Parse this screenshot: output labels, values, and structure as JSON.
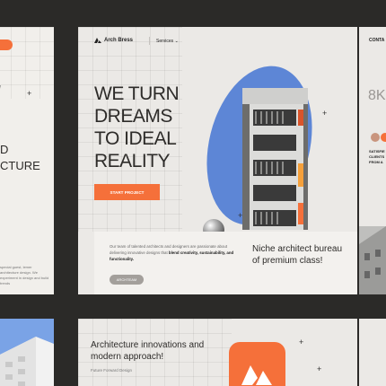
{
  "nav": {
    "brand": "Arch Bress",
    "services": "Services"
  },
  "hero": {
    "title": "WE TURN\nDREAMS\nTO IDEAL\nREALITY",
    "cta": "START PROJECT"
  },
  "info": {
    "text_plain": "Our team of talented architects and designers are passionate about delivering innovative designs that ",
    "text_bold": "blend creativity, sustainability, and functionality.",
    "tag": "ARCHTEAM",
    "tagline": "Niche architect bureau of premium class!"
  },
  "left_preview": {
    "title": "D\nCTURE",
    "small_text": "special guest, lemer architecture design. We experiment in design and build trends"
  },
  "right_preview": {
    "contact": "CONTA",
    "stat": "8K",
    "satisfied": "SATISFIE\nCLIENTS\nFROM A"
  },
  "bottom": {
    "title": "Architecture innovations and modern approach!",
    "subtitle": "Future Forward Design"
  },
  "colors": {
    "accent": "#f5703a",
    "background": "#2b2a28",
    "card": "#ebe9e6",
    "sky": "#5d86d6"
  },
  "icons": [
    "logo-icon",
    "chevron-down-icon",
    "plus-icon",
    "brand-app-icon"
  ]
}
